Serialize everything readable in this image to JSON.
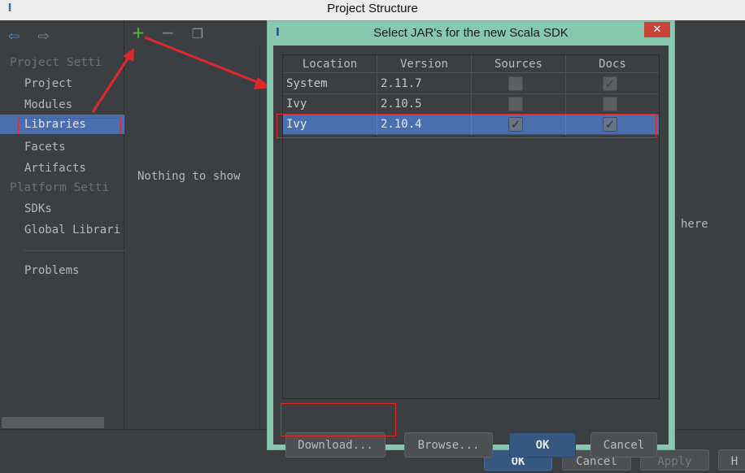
{
  "window": {
    "title": "Project Structure",
    "icon": "intellij-logo-icon"
  },
  "sidebar": {
    "nav": {
      "back_icon": "back-arrow-icon",
      "forward_icon": "forward-arrow-icon"
    },
    "project_settings_header": "Project Setti",
    "items": [
      {
        "label": "Project"
      },
      {
        "label": "Modules"
      },
      {
        "label": "Libraries",
        "selected": true
      },
      {
        "label": "Facets"
      },
      {
        "label": "Artifacts"
      }
    ],
    "platform_settings_header": "Platform Setti",
    "platform_items": [
      {
        "label": "SDKs"
      },
      {
        "label": "Global Librari"
      }
    ],
    "problems_label": "Problems"
  },
  "toolbar": {
    "add_icon": "plus-icon",
    "remove_icon": "minus-icon",
    "copy_icon": "copy-icon"
  },
  "main": {
    "empty_text": "Nothing to show",
    "right_text": "here"
  },
  "main_buttons": {
    "ok": "OK",
    "cancel": "Cancel",
    "apply": "Apply",
    "help": "H"
  },
  "dialog": {
    "title": "Select JAR's for the new Scala SDK",
    "close_glyph": "✕",
    "columns": [
      "Location",
      "Version",
      "Sources",
      "Docs"
    ],
    "rows": [
      {
        "location": "System",
        "version": "2.11.7",
        "sources": false,
        "docs": true
      },
      {
        "location": "Ivy",
        "version": "2.10.5",
        "sources": false,
        "docs": false
      },
      {
        "location": "Ivy",
        "version": "2.10.4",
        "sources": true,
        "docs": true,
        "selected": true
      }
    ],
    "buttons": {
      "download": "Download...",
      "browse": "Browse...",
      "ok": "OK",
      "cancel": "Cancel"
    }
  },
  "colors": {
    "accent": "#4b6eaf",
    "dialog_frame": "#86c9b0",
    "annotation": "#e0282c"
  }
}
